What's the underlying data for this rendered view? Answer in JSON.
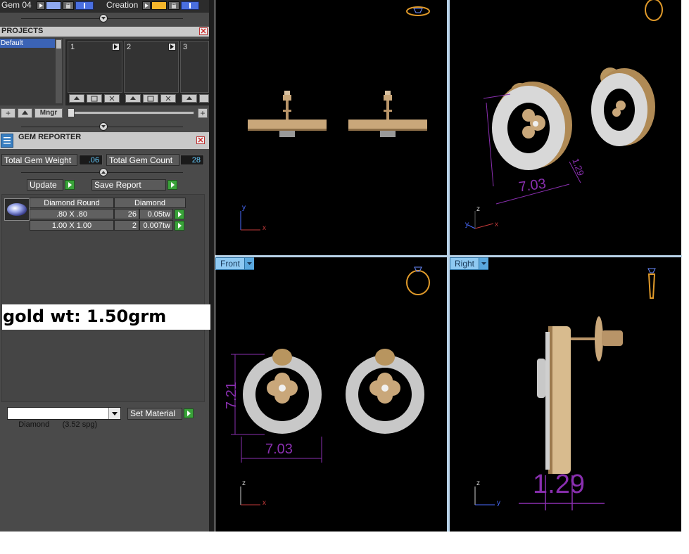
{
  "toolbar": {
    "gem_label": "Gem 04",
    "creation_label": "Creation"
  },
  "projects": {
    "title": "PROJECTS",
    "list_items": [
      "Default"
    ],
    "slots": [
      "1",
      "2",
      "3"
    ],
    "manager_label": "Mngr"
  },
  "gem_reporter": {
    "title": "GEM REPORTER",
    "total_weight_label": "Total Gem Weight",
    "total_weight_value": ".06",
    "total_count_label": "Total Gem Count",
    "total_count_value": "28",
    "update_label": "Update",
    "save_label": "Save Report",
    "table": {
      "headers": [
        "Diamond Round",
        "Diamond"
      ],
      "rows": [
        {
          "size": ".80 X .80",
          "count": "26",
          "weight": "0.05tw"
        },
        {
          "size": "1.00 X 1.00",
          "count": "2",
          "weight": "0.007tw"
        }
      ]
    }
  },
  "note": "gold wt: 1.50grm",
  "material": {
    "selected": "Diamond      (3.52 spg)",
    "set_label": "Set Material"
  },
  "viewports": {
    "front_label": "Front",
    "right_label": "Right",
    "perspective_dims": {
      "width": "7.03",
      "depth": "1.29"
    },
    "front_dims": {
      "width": "7.03",
      "height": "7.21"
    },
    "right_dims": {
      "depth": "1.29"
    },
    "axes": {
      "x": "x",
      "y": "y",
      "z": "z"
    }
  },
  "colors": {
    "panel_bg": "#4a4a4a",
    "viewport_bg": "#000000",
    "dimension": "#8a2fb0",
    "gold": "#d2b48c",
    "diamond": "#e6e6e6",
    "view_tab": "#8ec9f2",
    "accent_green": "#3aa33a"
  },
  "icons": [
    "gem-icon",
    "ring-icon",
    "earring-icon",
    "close-icon",
    "play-icon",
    "lock-icon",
    "dropdown-arrow-icon"
  ]
}
